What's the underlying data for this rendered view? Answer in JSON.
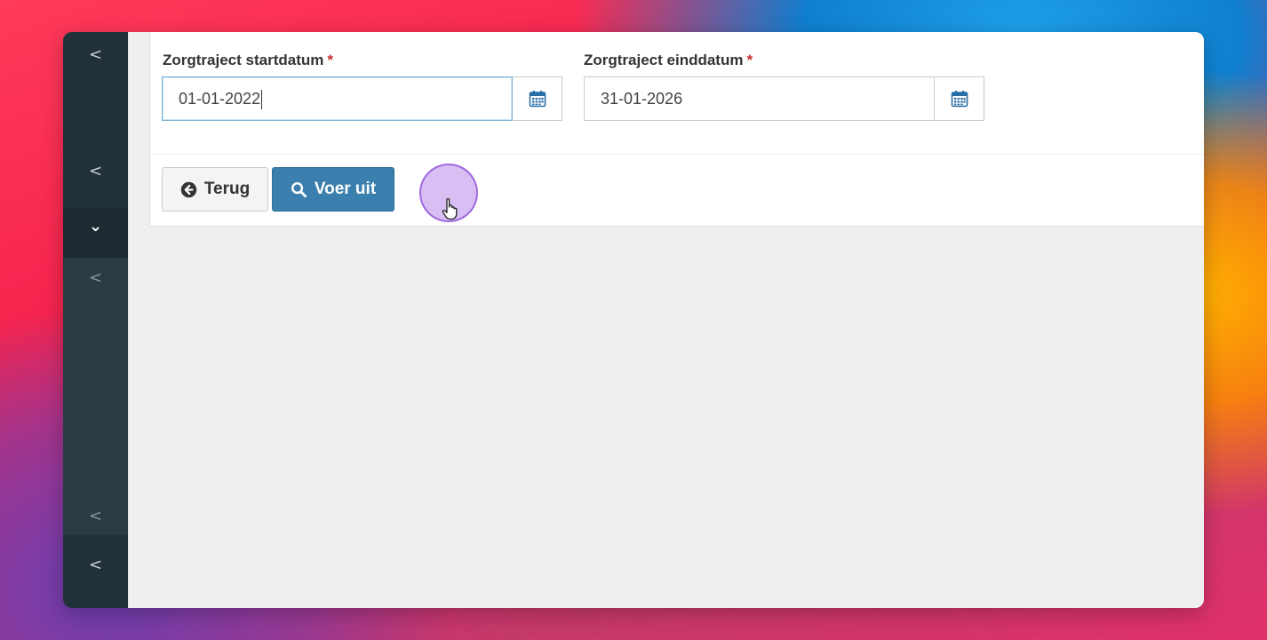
{
  "sidebar": {
    "chevrons": [
      "<",
      "<",
      "⌄",
      "<",
      "<",
      "<"
    ]
  },
  "form": {
    "start_date": {
      "label": "Zorgtraject startdatum",
      "required_mark": "*",
      "value": "01-01-2022",
      "icon": "calendar-icon"
    },
    "end_date": {
      "label": "Zorgtraject einddatum",
      "required_mark": "*",
      "value": "31-01-2026",
      "icon": "calendar-icon"
    }
  },
  "actions": {
    "back_label": "Terug",
    "back_icon": "arrow-circle-left-icon",
    "run_label": "Voer uit",
    "run_icon": "search-icon"
  },
  "colors": {
    "primary_button": "#3a7fad",
    "required": "#c9302c",
    "sidebar": "#2a3b44",
    "calendar_icon": "#2a6ea6"
  }
}
